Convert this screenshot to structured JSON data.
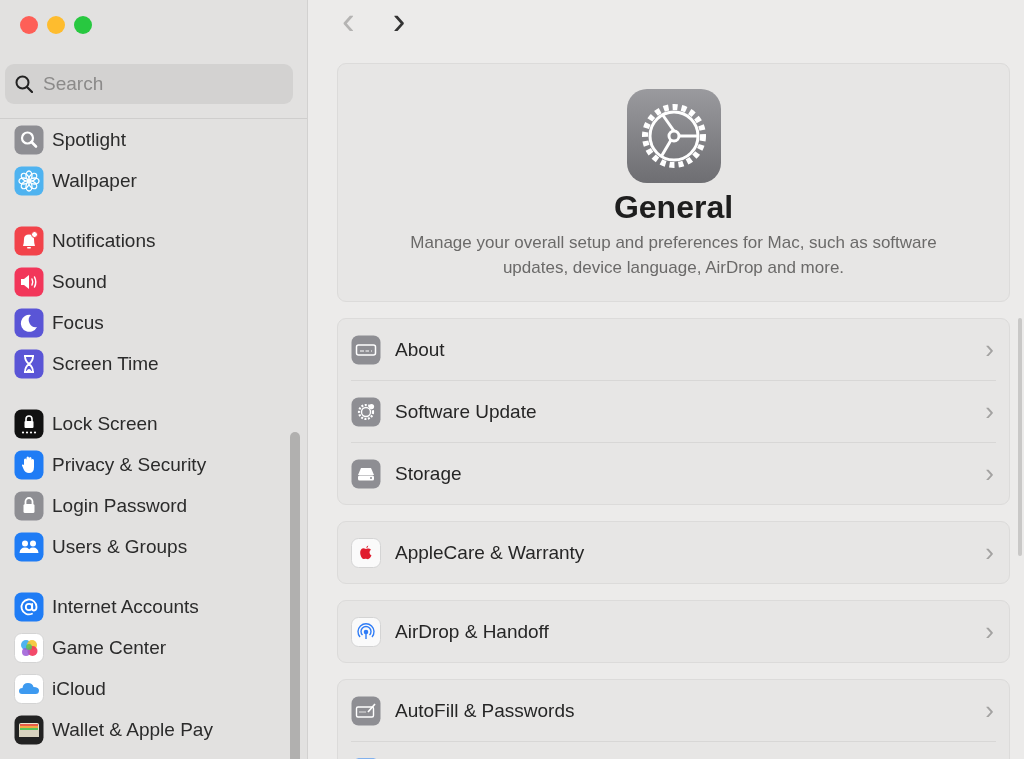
{
  "navigation": {
    "back": {
      "label": "‹",
      "disabled": true
    },
    "forward": {
      "label": "›",
      "disabled": false
    }
  },
  "search": {
    "placeholder": "Search"
  },
  "sidebar": {
    "groups": [
      {
        "items": [
          {
            "label": "Spotlight"
          },
          {
            "label": "Wallpaper"
          }
        ]
      },
      {
        "items": [
          {
            "label": "Notifications"
          },
          {
            "label": "Sound"
          },
          {
            "label": "Focus"
          },
          {
            "label": "Screen Time"
          }
        ]
      },
      {
        "items": [
          {
            "label": "Lock Screen"
          },
          {
            "label": "Privacy & Security"
          },
          {
            "label": "Login Password"
          },
          {
            "label": "Users & Groups"
          }
        ]
      },
      {
        "items": [
          {
            "label": "Internet Accounts"
          },
          {
            "label": "Game Center"
          },
          {
            "label": "iCloud"
          },
          {
            "label": "Wallet & Apple Pay"
          }
        ]
      }
    ]
  },
  "header": {
    "title": "General",
    "description": "Manage your overall setup and preferences for Mac, such as software updates, device language, AirDrop and more."
  },
  "sections": [
    {
      "rows": [
        {
          "kind": "full",
          "label": "About",
          "chevron": "›"
        },
        {
          "kind": "full",
          "label": "Software Update",
          "chevron": "›"
        },
        {
          "kind": "full",
          "label": "Storage",
          "chevron": "›"
        }
      ]
    },
    {
      "rows": [
        {
          "kind": "full",
          "label": "AppleCare & Warranty",
          "chevron": "›"
        }
      ]
    },
    {
      "rows": [
        {
          "kind": "full",
          "label": "AirDrop & Handoff",
          "chevron": "›"
        }
      ]
    },
    {
      "rows": [
        {
          "kind": "full",
          "label": "AutoFill & Passwords",
          "chevron": "›"
        },
        {
          "kind": "cut_off"
        }
      ]
    }
  ]
}
